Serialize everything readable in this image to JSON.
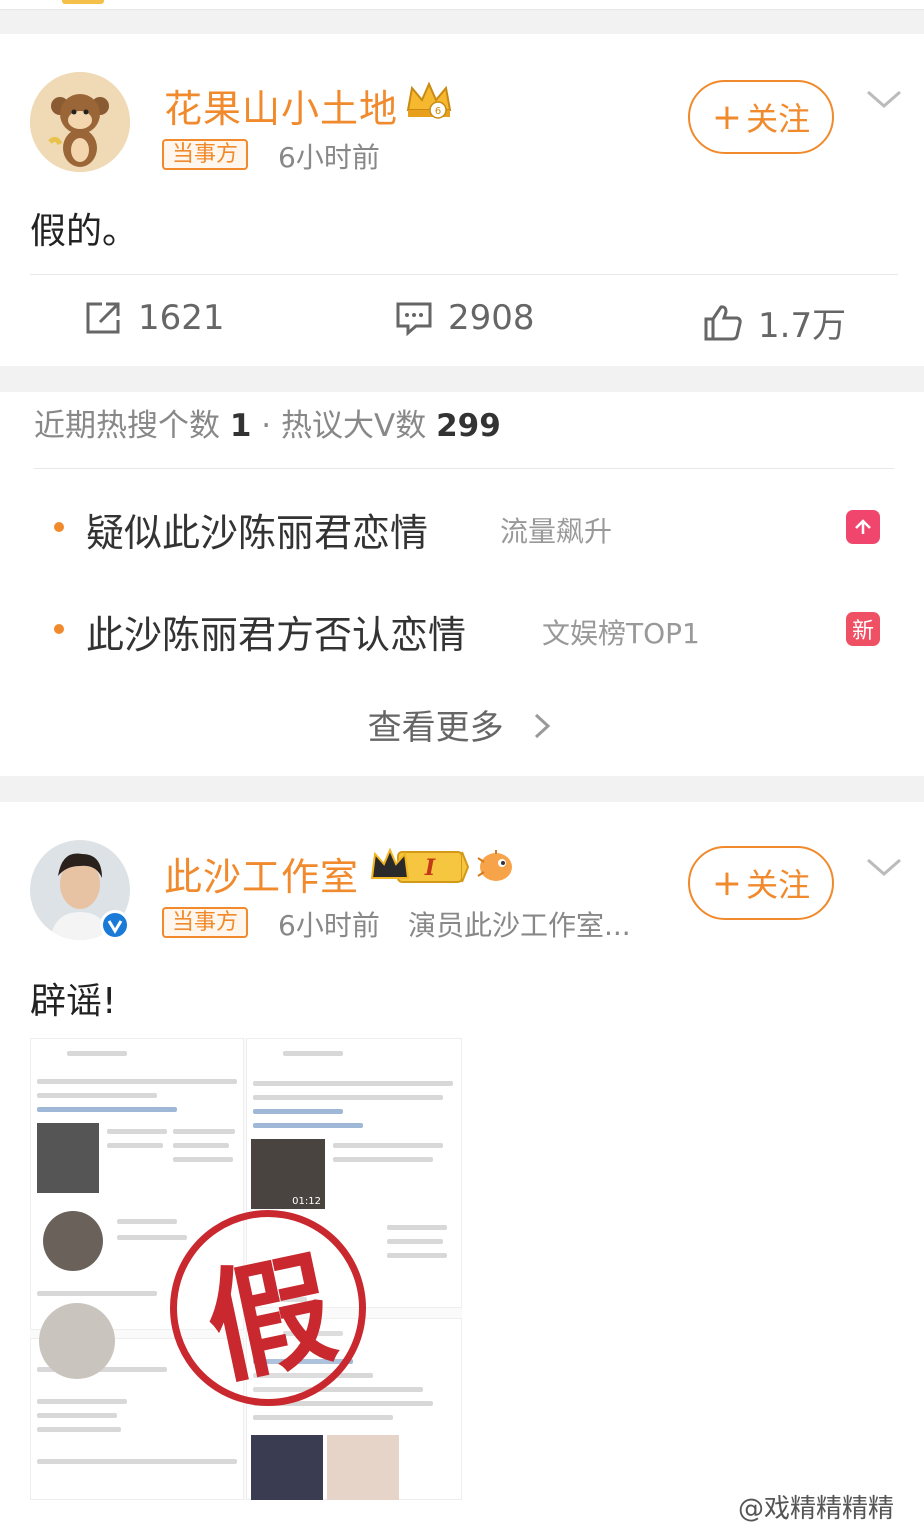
{
  "colors": {
    "accent": "#f08a2d",
    "hot_badge": "#f0466e",
    "new_badge": "#f05064",
    "verified": "#1a7ad8"
  },
  "post1": {
    "author": "花果山小土地",
    "badge": "当事方",
    "time": "6小时前",
    "follow_label": "关注",
    "text": "假的。",
    "reposts": "1621",
    "comments": "2908",
    "likes": "1.7万",
    "icons": [
      "crown-icon",
      "share-icon",
      "comment-icon",
      "like-icon",
      "chevron-down-icon"
    ]
  },
  "hot": {
    "label_recent": "近期热搜个数",
    "recent_count": "1",
    "separator": "·",
    "label_bigv": "热议大V数",
    "bigv_count": "299",
    "items": [
      {
        "title": "疑似此沙陈丽君恋情",
        "tag": "流量飙升",
        "badge": "",
        "badge_type": "trending-up-icon"
      },
      {
        "title": "此沙陈丽君方否认恋情",
        "tag": "文娱榜TOP1",
        "badge": "新",
        "badge_type": "new-badge"
      }
    ],
    "more_label": "查看更多"
  },
  "post2": {
    "author": "此沙工作室",
    "badge": "当事方",
    "time": "6小时前",
    "source": "演员此沙工作室...",
    "follow_label": "关注",
    "text": "辟谣!",
    "stamp_text": "假",
    "image_label": "01:12",
    "level": "I"
  },
  "watermark": "@戏精精精精"
}
